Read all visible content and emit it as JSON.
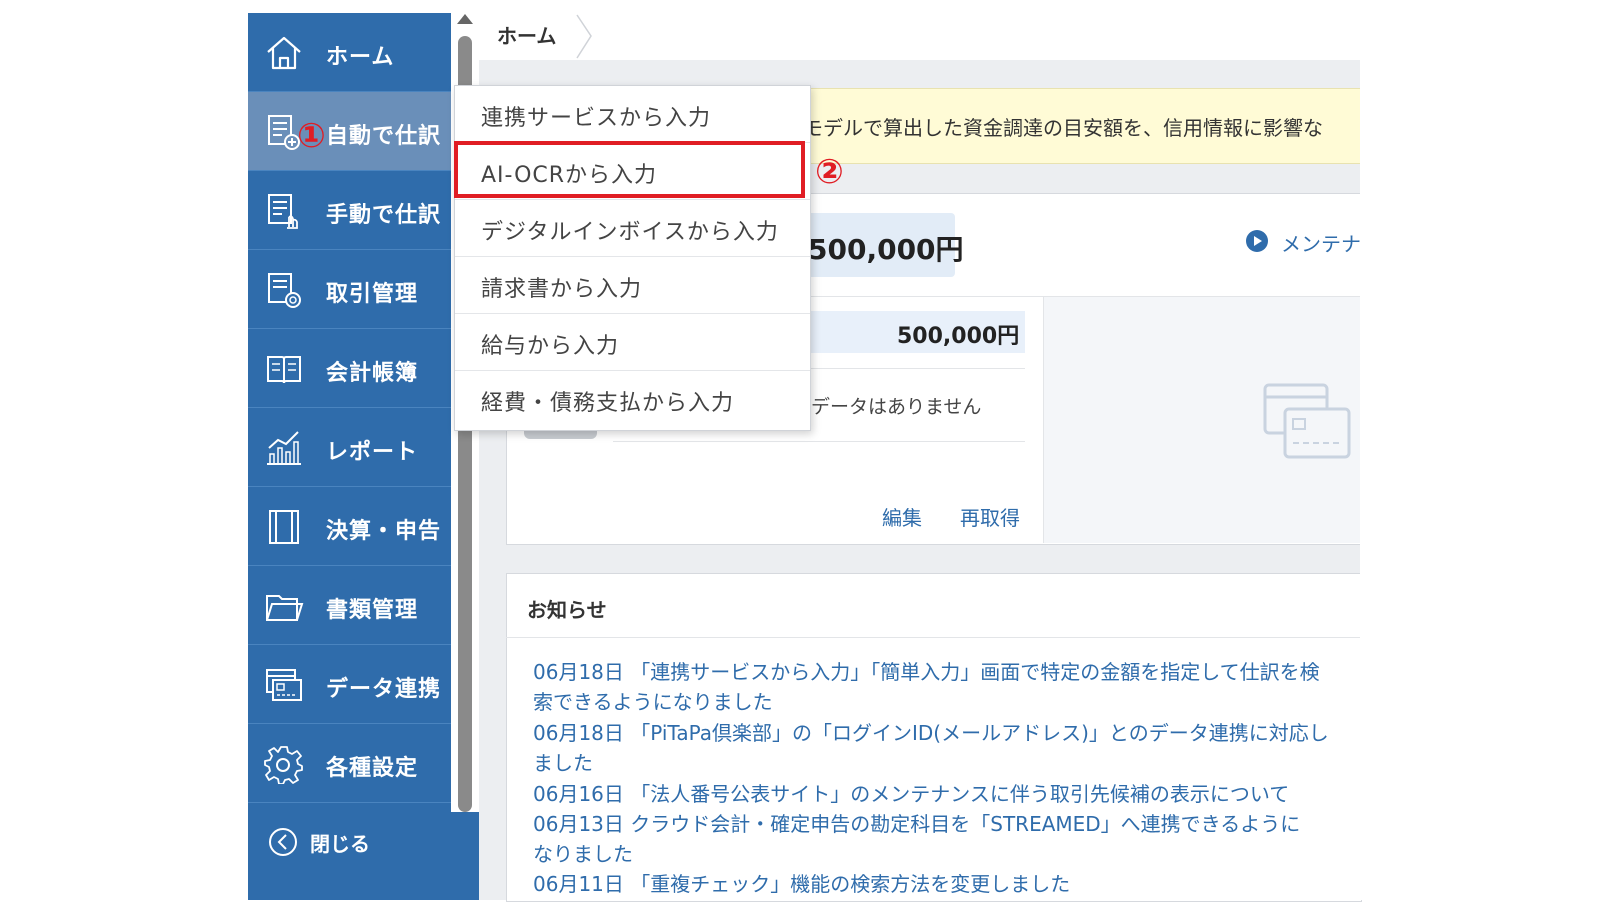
{
  "breadcrumb": {
    "home": "ホーム"
  },
  "sidebar": {
    "items": [
      {
        "label": "ホーム",
        "icon": "home-icon"
      },
      {
        "label": "自動で仕訳",
        "icon": "auto-journal-icon"
      },
      {
        "label": "手動で仕訳",
        "icon": "manual-journal-icon"
      },
      {
        "label": "取引管理",
        "icon": "transaction-icon"
      },
      {
        "label": "会計帳簿",
        "icon": "ledger-book-icon"
      },
      {
        "label": "レポート",
        "icon": "report-chart-icon"
      },
      {
        "label": "決算・申告",
        "icon": "settlement-icon"
      },
      {
        "label": "書類管理",
        "icon": "folder-icon"
      },
      {
        "label": "データ連携",
        "icon": "data-link-icon"
      },
      {
        "label": "各種設定",
        "icon": "gear-icon"
      }
    ],
    "close_label": "閉じる"
  },
  "dropdown": {
    "items": [
      "連携サービスから入力",
      "AI-OCRから入力",
      "デジタルインボイスから入力",
      "請求書から入力",
      "給与から入力",
      "経費・債務支払から入力"
    ]
  },
  "annotations": {
    "step1": "①",
    "step2": "②"
  },
  "notice": {
    "text": "モデルで算出した資金調達の目安額を、信用情報に影響な"
  },
  "summary": {
    "amount": "500,000円",
    "maintenance_link": "メンテナ",
    "account_amount": "500,000円",
    "no_data": "データはありません",
    "edit": "編集",
    "refresh": "再取得"
  },
  "news": {
    "title": "お知らせ",
    "lines": [
      "06月18日 「連携サービスから入力」「簡単入力」画面で特定の金額を指定して仕訳を検",
      "索できるようになりました",
      "06月18日 「PiTaPa倶楽部」の「ログインID(メールアドレス)」とのデータ連携に対応し",
      "ました",
      "06月16日 「法人番号公表サイト」のメンテナンスに伴う取引先候補の表示について",
      "06月13日 クラウド会計・確定申告の勘定科目を「STREAMED」へ連携できるように",
      "なりました",
      "06月11日 「重複チェック」機能の検索方法を変更しました"
    ]
  },
  "colors": {
    "sidebar": "#2f6cab",
    "sidebar_active": "#6a8fb9",
    "highlight": "#e01d24",
    "link": "#2f6cab",
    "notice_bg": "#fffbd6"
  }
}
